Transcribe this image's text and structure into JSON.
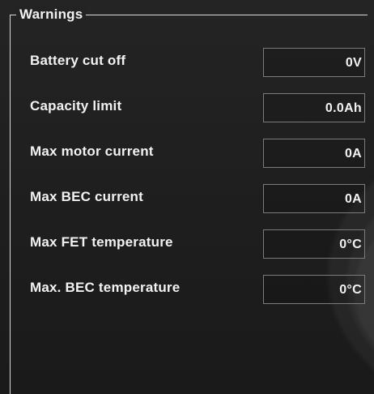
{
  "group": {
    "title": "Warnings"
  },
  "rows": [
    {
      "label": "Battery cut off",
      "value": "0V"
    },
    {
      "label": "Capacity limit",
      "value": "0.0Ah"
    },
    {
      "label": "Max motor current",
      "value": "0A"
    },
    {
      "label": "Max BEC current",
      "value": "0A"
    },
    {
      "label": "Max FET temperature",
      "value": "0°C"
    },
    {
      "label": "Max. BEC temperature",
      "value": "0°C"
    }
  ]
}
